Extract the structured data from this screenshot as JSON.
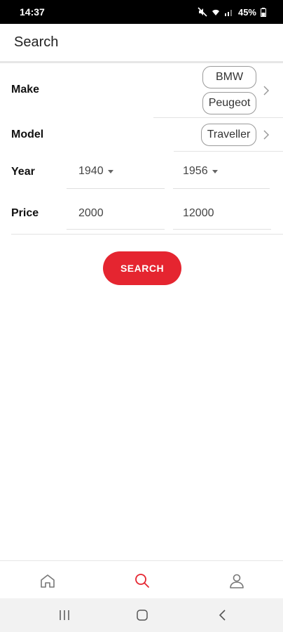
{
  "status_bar": {
    "time": "14:37",
    "battery": "45%"
  },
  "app_bar": {
    "title": "Search"
  },
  "form": {
    "make": {
      "label": "Make",
      "chips": [
        "BMW",
        "Peugeot"
      ]
    },
    "model": {
      "label": "Model",
      "chips": [
        "Traveller"
      ]
    },
    "year": {
      "label": "Year",
      "from": "1940",
      "to": "1956"
    },
    "price": {
      "label": "Price",
      "from": "2000",
      "to": "12000"
    }
  },
  "search_button": {
    "label": "SEARCH"
  },
  "bottom_nav": {
    "items": [
      "home-icon",
      "search-icon",
      "profile-icon"
    ],
    "active": "search-icon",
    "active_color": "#e52530"
  },
  "colors": {
    "accent": "#e52530"
  }
}
